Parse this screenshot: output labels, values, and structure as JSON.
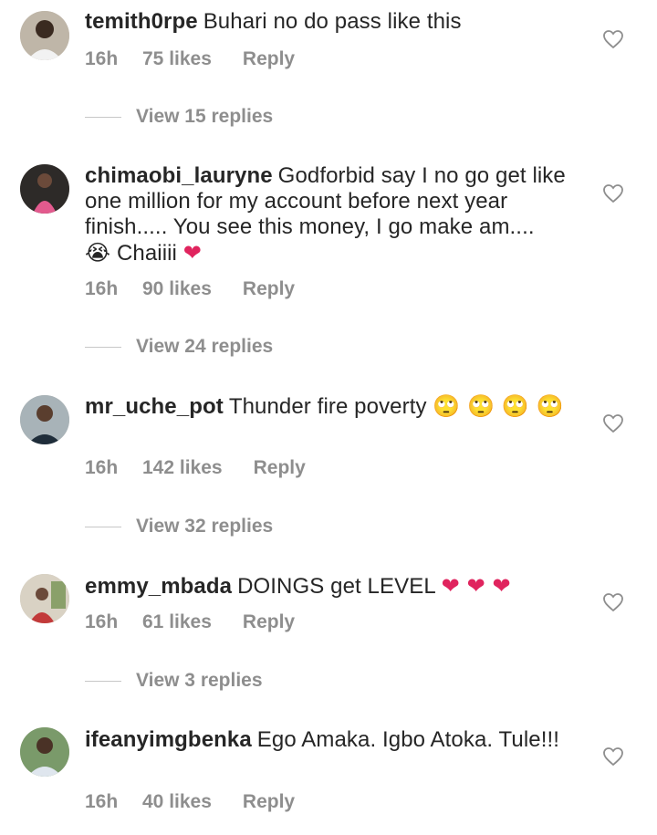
{
  "comments": [
    {
      "username": "temith0rpe",
      "text": "Buhari no do pass like this",
      "time": "16h",
      "likes": "75 likes",
      "reply": "Reply",
      "view_replies": "View 15 replies"
    },
    {
      "username": "chimaobi_lauryne",
      "text": "Godforbid say I no go get like one million for my account before next year finish..... You see this money, I go make am....",
      "text_tail": "Chaiiii",
      "emoji_before_tail": "😭",
      "emoji_after_tail": "❤",
      "time": "16h",
      "likes": "90 likes",
      "reply": "Reply",
      "view_replies": "View 24 replies"
    },
    {
      "username": "mr_uche_pot",
      "text": "Thunder fire poverty",
      "emojis": "🙄 🙄 🙄 🙄",
      "time": "16h",
      "likes": "142 likes",
      "reply": "Reply",
      "view_replies": "View 32 replies"
    },
    {
      "username": "emmy_mbada",
      "text": "DOINGS get LEVEL",
      "emojis": "❤ ❤ ❤",
      "time": "16h",
      "likes": "61 likes",
      "reply": "Reply",
      "view_replies": "View 3 replies"
    },
    {
      "username": "ifeanyimgbenka",
      "text": "Ego Amaka. Igbo Atoka. Tule!!!",
      "time": "16h",
      "likes": "40 likes",
      "reply": "Reply"
    }
  ],
  "icons": {
    "like": "heart-outline-icon"
  },
  "colors": {
    "text": "#262626",
    "meta": "#8e8e8e",
    "heart_emoji": "#e0245e"
  }
}
